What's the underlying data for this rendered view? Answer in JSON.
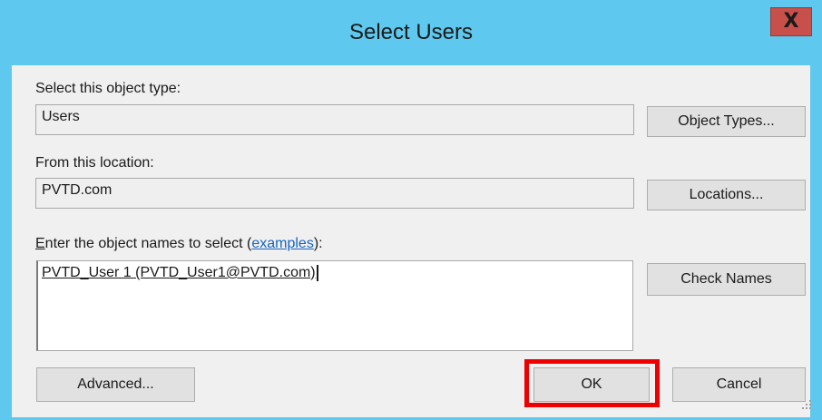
{
  "window": {
    "title": "Select Users",
    "close_symbol": "X",
    "close_icon": "close-icon"
  },
  "object_type": {
    "label": "Select this object type:",
    "value": "Users",
    "button_label": "Object Types..."
  },
  "location": {
    "label": "From this location:",
    "value": "PVTD.com",
    "button_label": "Locations..."
  },
  "names": {
    "label_accesskey": "E",
    "label_rest": "nter the object names to select (",
    "link_text": "examples",
    "label_end": "):",
    "value": "PVTD_User 1 (PVTD_User1@PVTD.com)",
    "button_label": "Check Names"
  },
  "footer": {
    "advanced_label": "Advanced...",
    "ok_label": "OK",
    "cancel_label": "Cancel"
  },
  "colors": {
    "titlebar": "#5ec8ee",
    "close_button": "#c7504a",
    "highlight": "#ee0000",
    "link": "#1565c0"
  }
}
